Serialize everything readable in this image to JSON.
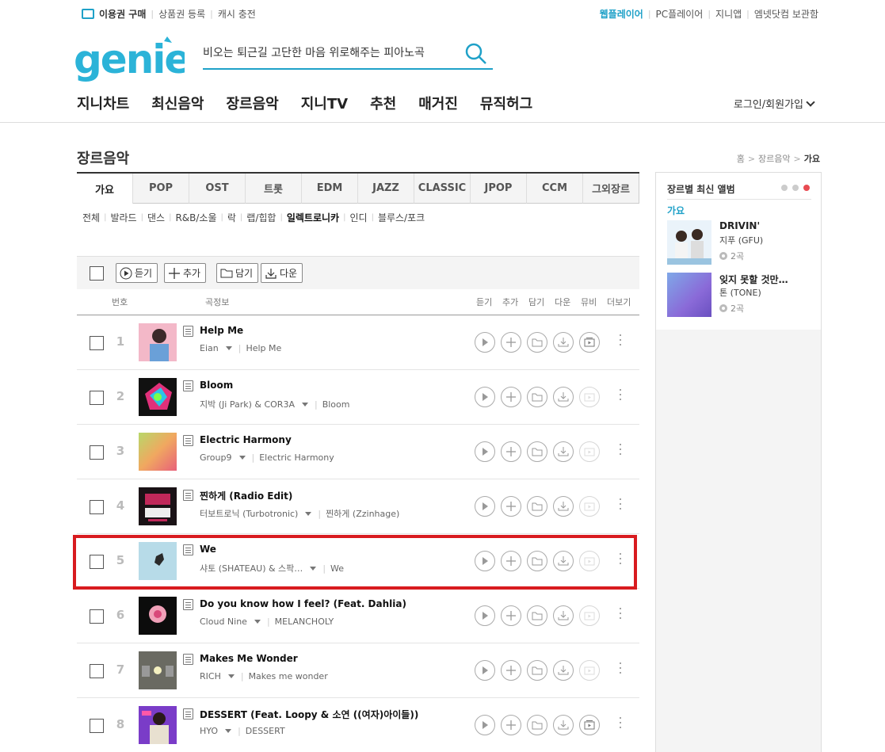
{
  "util": {
    "buy_ticket": "이용권 구매",
    "register_gift": "상품권 등록",
    "cash_charge": "캐시 충전",
    "web_player": "웹플레이어",
    "pc_player": "PC플레이어",
    "genie_app": "지니앱",
    "mnet_archive": "엠넷닷컴 보관함"
  },
  "search": {
    "placeholder": "비오는 퇴근길 고단한 마음 위로해주는 피아노곡"
  },
  "gnb": [
    "지니차트",
    "최신음악",
    "장르음악",
    "지니TV",
    "추천",
    "매거진",
    "뮤직허그"
  ],
  "login": "로그인/회원가입",
  "page_title": "장르음악",
  "breadcrumb": {
    "home": "홈",
    "section": "장르음악",
    "current": "가요"
  },
  "tabs": [
    "가요",
    "POP",
    "OST",
    "트롯",
    "EDM",
    "JAZZ",
    "CLASSIC",
    "JPOP",
    "CCM",
    "그외장르"
  ],
  "subgenres": [
    "전체",
    "발라드",
    "댄스",
    "R&B/소울",
    "락",
    "랩/힙합",
    "일렉트로니카",
    "인디",
    "블루스/포크"
  ],
  "toolbar": {
    "listen": "듣기",
    "add": "추가",
    "save": "담기",
    "download": "다운"
  },
  "columns": {
    "no": "번호",
    "info": "곡정보",
    "listen": "듣기",
    "add": "추가",
    "save": "담기",
    "download": "다운",
    "mv": "뮤비",
    "more": "더보기"
  },
  "songs": [
    {
      "rank": "1",
      "title": "Help Me",
      "artist": "Eian",
      "album": "Help Me",
      "mv": true
    },
    {
      "rank": "2",
      "title": "Bloom",
      "artist": "지박 (Ji Park) & COR3A",
      "album": "Bloom",
      "mv": false
    },
    {
      "rank": "3",
      "title": "Electric Harmony",
      "artist": "Group9",
      "album": "Electric Harmony",
      "mv": false
    },
    {
      "rank": "4",
      "title": "찐하게 (Radio Edit)",
      "artist": "터보트로닉 (Turbotronic)",
      "album": "찐하게 (Zzinhage)",
      "mv": false
    },
    {
      "rank": "5",
      "title": "We",
      "artist": "샤토 (SHATEAU) & 스팍…",
      "album": "We",
      "mv": false
    },
    {
      "rank": "6",
      "title": "Do you know how I feel? (Feat. Dahlia)",
      "artist": "Cloud Nine",
      "album": "MELANCHOLY",
      "mv": false
    },
    {
      "rank": "7",
      "title": "Makes Me Wonder",
      "artist": "RICH",
      "album": "Makes me wonder",
      "mv": false
    },
    {
      "rank": "8",
      "title": "DESSERT (Feat. Loopy & 소연 ((여자)아이들))",
      "artist": "HYO",
      "album": "DESSERT",
      "mv": true
    }
  ],
  "sidebar": {
    "title": "장르별 최신 앨범",
    "category": "가요",
    "albums": [
      {
        "title": "DRIVIN'",
        "artist": "지푸 (GFU)",
        "count": "2곡"
      },
      {
        "title": "잊지 못할 것만…",
        "artist": "톤 (TONE)",
        "count": "2곡"
      }
    ]
  },
  "colors": {
    "accent": "#1fa1c8",
    "highlight": "#d81b1f"
  }
}
